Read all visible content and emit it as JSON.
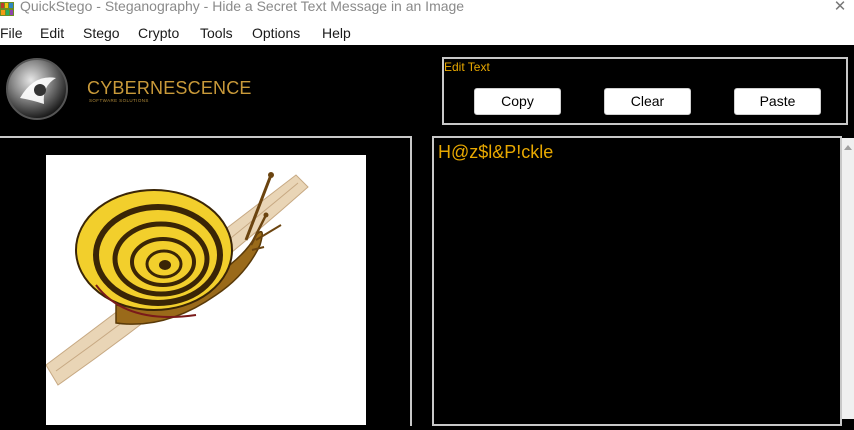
{
  "window": {
    "title": "QuickStego - Steganography - Hide a Secret Text Message in an Image",
    "close_glyph": "✕"
  },
  "menu": [
    "File",
    "Edit",
    "Stego",
    "Crypto",
    "Tools",
    "Options",
    "Help"
  ],
  "logo": {
    "name": "CYBERNESCENCE",
    "tagline": "SOFTWARE SOLUTIONS"
  },
  "edit_text": {
    "label": "Edit Text",
    "copy": "Copy",
    "clear": "Clear",
    "paste": "Paste"
  },
  "message": {
    "text": "H@z$l&P!ckle"
  },
  "image": {
    "subject": "snail-illustration"
  },
  "colors": {
    "accent": "#e8a800",
    "logo_gold": "#c99a3a",
    "background": "#000000"
  }
}
